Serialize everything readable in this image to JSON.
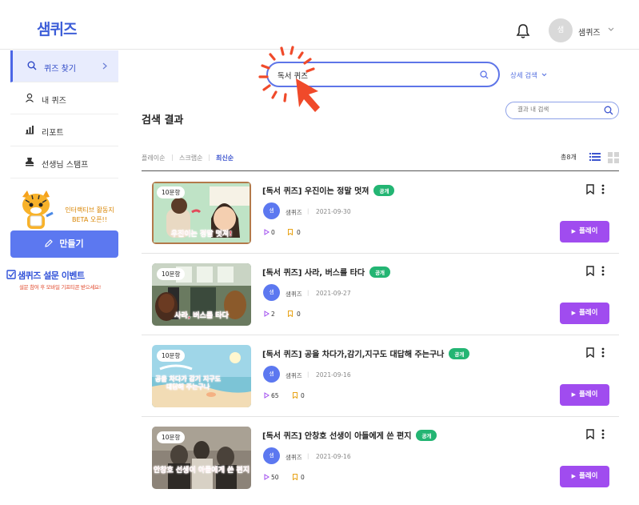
{
  "header": {
    "logo": "샘퀴즈",
    "user_avatar": "샘",
    "user_name": "샘퀴즈"
  },
  "sidebar": {
    "items": [
      {
        "label": "퀴즈 찾기",
        "icon": "search-icon",
        "active": true
      },
      {
        "label": "내 퀴즈",
        "icon": "person-icon",
        "active": false
      },
      {
        "label": "리포트",
        "icon": "chart-icon",
        "active": false
      },
      {
        "label": "선생님 스탬프",
        "icon": "stamp-icon",
        "active": false
      }
    ],
    "promo_line1": "인터랙티브 활동지",
    "promo_line2": "BETA 오픈!!",
    "make_button": "만들기",
    "survey_title": "샘퀴즈 설문 이벤트",
    "survey_sub": "설문 참여 후 모바일 기프티콘 받으세요!"
  },
  "search": {
    "value": "독서 퀴즈",
    "advanced": "상세 검색"
  },
  "results": {
    "title": "검색 결과",
    "in_search_placeholder": "결과 내 검색",
    "sort": [
      "플레이순",
      "스크랩순",
      "최신순"
    ],
    "active_sort": "최신순",
    "total": "총8개",
    "items": [
      {
        "title": "[독서 퀴즈] 우진이는 정말 멋져",
        "badge": "공개",
        "author_avatar": "샘",
        "author": "샘퀴즈",
        "date": "2021-09-30",
        "plays": "0",
        "saves": "0",
        "questions": "10문항",
        "caption": "우진이는 정말 멋져!",
        "play_label": "플레이"
      },
      {
        "title": "[독서 퀴즈] 사라, 버스를 타다",
        "badge": "공개",
        "author_avatar": "샘",
        "author": "샘퀴즈",
        "date": "2021-09-27",
        "plays": "2",
        "saves": "0",
        "questions": "10문항",
        "caption": "사라, 버스를 타다",
        "play_label": "플레이"
      },
      {
        "title": "[독서 퀴즈] 공을 차다가,감기,지구도 대답해 주는구나",
        "badge": "공개",
        "author_avatar": "샘",
        "author": "샘퀴즈",
        "date": "2021-09-16",
        "plays": "65",
        "saves": "0",
        "questions": "10문항",
        "caption": "공을 차다가 감기 지구도 대답해 주는구나",
        "play_label": "플레이"
      },
      {
        "title": "[독서 퀴즈] 안창호 선생이 아들에게 쓴 편지",
        "badge": "공개",
        "author_avatar": "샘",
        "author": "샘퀴즈",
        "date": "2021-09-16",
        "plays": "50",
        "saves": "0",
        "questions": "10문항",
        "caption": "안창호 선생이 아들에게 쓴 편지",
        "play_label": "플레이"
      }
    ]
  },
  "colors": {
    "brand": "#3d5ed8",
    "play": "#a04cef",
    "public_badge": "#23b573",
    "highlight": "#f04a2a"
  }
}
